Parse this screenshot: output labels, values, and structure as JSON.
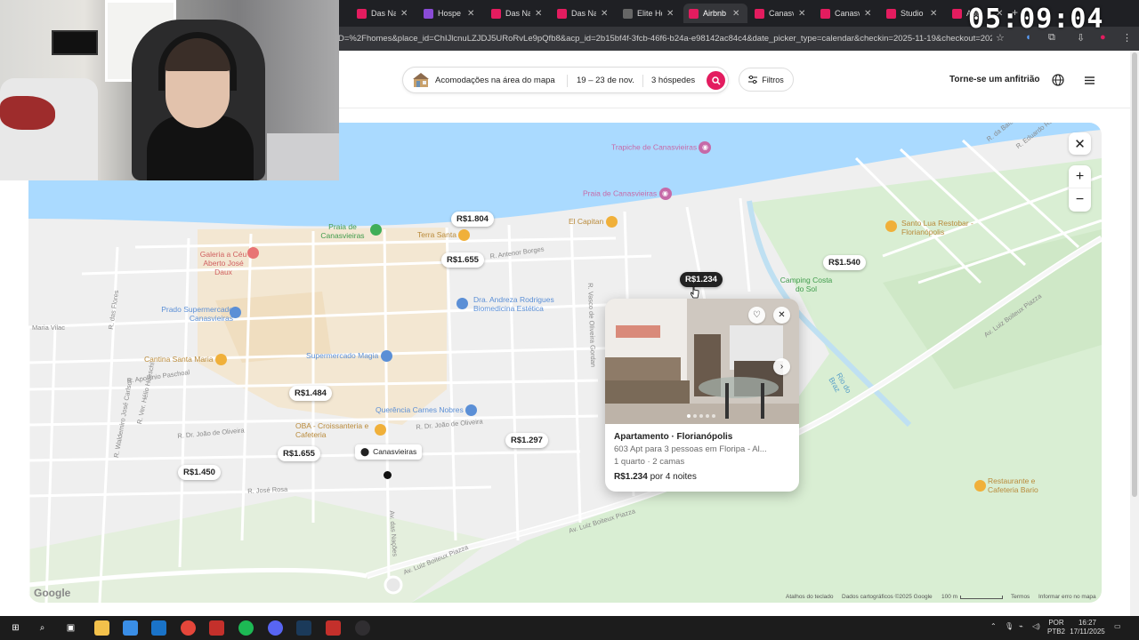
{
  "browser": {
    "tabs": [
      {
        "label": "Das Na",
        "icon": "airbnb-icon",
        "active": false
      },
      {
        "label": "Hospe",
        "icon": "hospede-icon",
        "active": false
      },
      {
        "label": "Das Na",
        "icon": "airbnb-icon",
        "active": false
      },
      {
        "label": "Das Na",
        "icon": "airbnb-icon",
        "active": false
      },
      {
        "label": "Elite Ho",
        "icon": "elite-icon",
        "active": false
      },
      {
        "label": "Airbnb",
        "icon": "airbnb-icon",
        "active": true
      },
      {
        "label": "Canasv",
        "icon": "airbnb-icon",
        "active": false
      },
      {
        "label": "Canasv",
        "icon": "airbnb-icon",
        "active": false
      },
      {
        "label": "Studio",
        "icon": "airbnb-icon",
        "active": false
      },
      {
        "label": "Apt",
        "icon": "airbnb-icon",
        "active": false
      }
    ],
    "url": "D=%2Fhomes&place_id=ChIJlcnuLZJDJ5URoRvLe9pQfb8&acp_id=2b15bf4f-3fcb-46f6-b24a-e98142ac84c4&date_picker_type=calendar&checkin=2025-11-19&checkout=2025..."
  },
  "overlay_clock": "05:09:04",
  "header": {
    "search_place": "Acomodações na área do mapa",
    "search_dates": "19 – 23 de nov.",
    "search_guests": "3 hóspedes",
    "filters_label": "Filtros",
    "host_label": "Torne-se um anfitrião"
  },
  "map": {
    "price_pins": [
      {
        "label": "R$1.804",
        "selected": false
      },
      {
        "label": "R$1.655",
        "selected": false
      },
      {
        "label": "R$1.234",
        "selected": true
      },
      {
        "label": "R$1.540",
        "selected": false
      },
      {
        "label": "R$1.484",
        "selected": false
      },
      {
        "label": "R$1.297",
        "selected": false
      },
      {
        "label": "R$1.655",
        "selected": false
      },
      {
        "label": "R$1.450",
        "selected": false
      }
    ],
    "pois": [
      {
        "label": "Trapiche de Canasvieiras",
        "color": "#c66aa8"
      },
      {
        "label": "Praia de Canasvieiras",
        "color": "#c66aa8"
      },
      {
        "label": "El Capitan",
        "color": "#b98a3a"
      },
      {
        "label": "Terra Santa",
        "color": "#b98a3a"
      },
      {
        "label": "Praia de Canasvieiras",
        "color": "#3f9b4b"
      },
      {
        "label": "Galeria a Céu Aberto José Daux",
        "color": "#d06060"
      },
      {
        "label": "Dra. Andreza Rodrigues Biomedicina Estética",
        "color": "#5b8fd6"
      },
      {
        "label": "Prado Supermercado Canasvieiras",
        "color": "#5b8fd6"
      },
      {
        "label": "Supermercado Magia",
        "color": "#5b8fd6"
      },
      {
        "label": "Cantina Santa Maria",
        "color": "#b98a3a"
      },
      {
        "label": "Querência Carnes Nobres",
        "color": "#5b8fd6"
      },
      {
        "label": "OBA - Croissanteria e Cafeteria",
        "color": "#b98a3a"
      },
      {
        "label": "Santo Lua Restobar - Florianópolis",
        "color": "#b98a3a"
      },
      {
        "label": "Camping Costa do Sol",
        "color": "#3f9b4b"
      },
      {
        "label": "Restaurante e Cafeteria Bario",
        "color": "#b98a3a"
      },
      {
        "label": "Rio do Braz",
        "color": "#5aa0c8"
      }
    ],
    "place_label": "Canasvieiras",
    "streets": [
      "R. Antenor Borges",
      "R. Vasco de Oliveira Gordan",
      "Av. Luiz Boiteux Piazza",
      "Av. Luiz Boiteux Piazza",
      "Av. Luiz Boiteux Piazza",
      "R. Dr. João de Oliveira",
      "R. Dr. João de Oliveira",
      "R. José Rosa",
      "Av. das Nações",
      "R. Apolônio Paschoal",
      "Maria Vilac",
      "R. das Flores",
      "R. Waldemiro José Carlson",
      "R. Ver. Hélio Hoeschl",
      "R. Eduardo Rosa",
      "R. da Baía"
    ],
    "attribution": {
      "shortcuts": "Atalhos do teclado",
      "data": "Dados cartográficos ©2025 Google",
      "scale": "100 m",
      "terms": "Termos",
      "report": "Informar erro no mapa",
      "logo": "Google"
    }
  },
  "listing": {
    "title": "Apartamento · Florianópolis",
    "description": "603 Apt para 3 pessoas em Floripa - Al...",
    "beds": "1 quarto · 2 camas",
    "price_amount": "R$1.234",
    "price_suffix": "por 4 noites"
  },
  "taskbar": {
    "apps": [
      "start-icon",
      "search-icon",
      "task-view-icon",
      "file-explorer-icon",
      "store-icon",
      "outlook-icon",
      "chrome-icon",
      "voicemeeter-icon",
      "spotify-icon",
      "discord-icon",
      "steam-icon",
      "voicemeeter-icon",
      "obs-icon"
    ],
    "lang_top": "POR",
    "lang_bottom": "PTB2",
    "time": "16:27",
    "date": "17/11/2025"
  },
  "colors": {
    "brand": "#e31c5f",
    "water": "#aadaff",
    "park": "#d9eed3",
    "urban": "#f3e7d2"
  }
}
